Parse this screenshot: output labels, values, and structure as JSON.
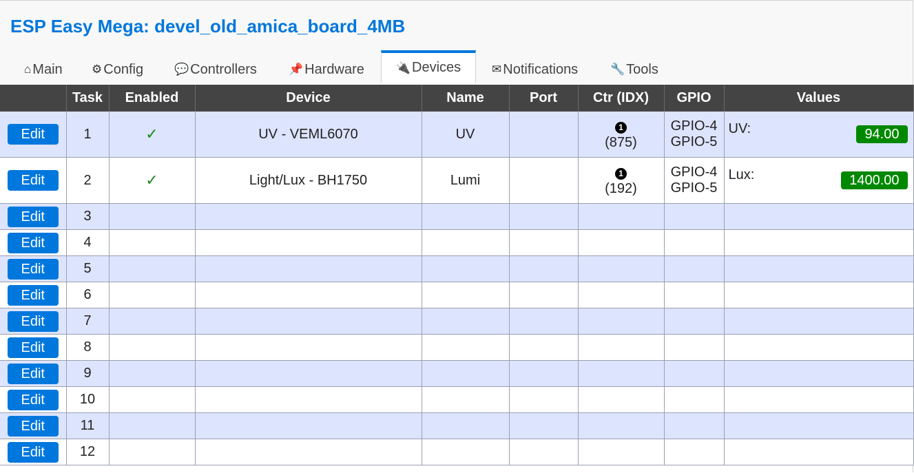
{
  "header": {
    "title": "ESP Easy Mega: devel_old_amica_board_4MB"
  },
  "tabs": [
    {
      "icon": "⌂",
      "label": "Main"
    },
    {
      "icon": "⚙",
      "label": "Config"
    },
    {
      "icon": "💬",
      "label": "Controllers"
    },
    {
      "icon": "📌",
      "label": "Hardware"
    },
    {
      "icon": "🔌",
      "label": "Devices"
    },
    {
      "icon": "✉",
      "label": "Notifications"
    },
    {
      "icon": "🔧",
      "label": "Tools"
    }
  ],
  "active_tab": "Devices",
  "table": {
    "columns": [
      "",
      "Task",
      "Enabled",
      "Device",
      "Name",
      "Port",
      "Ctr (IDX)",
      "GPIO",
      "Values"
    ],
    "edit_label": "Edit",
    "rows": [
      {
        "task": "1",
        "enabled": "✓",
        "device": "UV - VEML6070",
        "name": "UV",
        "port": "",
        "ctr_num": "1",
        "ctr_idx": "(875)",
        "gpio1": "GPIO-4",
        "gpio2": "GPIO-5",
        "value_name": "UV:",
        "value": "94.00"
      },
      {
        "task": "2",
        "enabled": "✓",
        "device": "Light/Lux - BH1750",
        "name": "Lumi",
        "port": "",
        "ctr_num": "1",
        "ctr_idx": "(192)",
        "gpio1": "GPIO-4",
        "gpio2": "GPIO-5",
        "value_name": "Lux:",
        "value": "1400.00"
      },
      {
        "task": "3"
      },
      {
        "task": "4"
      },
      {
        "task": "5"
      },
      {
        "task": "6"
      },
      {
        "task": "7"
      },
      {
        "task": "8"
      },
      {
        "task": "9"
      },
      {
        "task": "10"
      },
      {
        "task": "11"
      },
      {
        "task": "12"
      }
    ]
  },
  "colors": {
    "accent": "#0077dd",
    "value_badge": "#008800",
    "header_bg": "#444444",
    "odd_row": "#dde4fd"
  }
}
